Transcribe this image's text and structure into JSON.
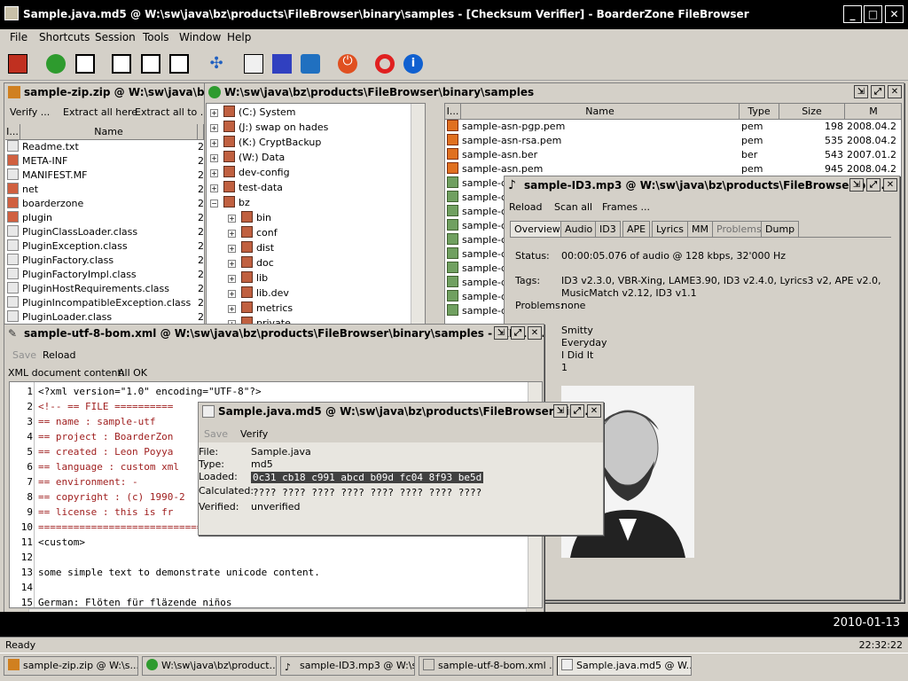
{
  "app": {
    "title": "Sample.java.md5 @ W:\\sw\\java\\bz\\products\\FileBrowser\\binary\\samples - [Checksum Verifier] - BoarderZone FileBrowser"
  },
  "menu": [
    "File",
    "Shortcuts",
    "Session",
    "Tools",
    "Window",
    "Help"
  ],
  "zip": {
    "title": "sample-zip.zip @ W:\\sw\\java\\bz\\pr",
    "toolbar": [
      "Verify ...",
      "Extract all here",
      "Extract all to ..."
    ],
    "col_i": "I...",
    "col_name": "Name",
    "files": [
      "Readme.txt",
      "META-INF",
      "MANIFEST.MF",
      "net",
      "boarderzone",
      "plugin",
      "PluginClassLoader.class",
      "PluginException.class",
      "PluginFactory.class",
      "PluginFactoryImpl.class",
      "PluginHostRequirements.class",
      "PluginIncompatibleException.class",
      "PluginLoader.class"
    ],
    "sizes": [
      "2",
      "2",
      "2",
      "2",
      "2",
      "2",
      "2",
      "2",
      "2",
      "2",
      "2",
      "2",
      "2"
    ]
  },
  "browser": {
    "title": "W:\\sw\\java\\bz\\products\\FileBrowser\\binary\\samples",
    "tree": [
      "(C:) System",
      "(J:) swap on hades",
      "(K:) CryptBackup",
      "(W:) Data",
      "dev-config",
      "test-data",
      "bz",
      "bin",
      "conf",
      "dist",
      "doc",
      "lib",
      "lib.dev",
      "metrics",
      "private"
    ],
    "cols": {
      "i": "I...",
      "name": "Name",
      "type": "Type",
      "size": "Size",
      "m": "M"
    },
    "files": [
      {
        "name": "sample-asn-pgp.pem",
        "type": "pem",
        "size": "198",
        "date": "2008.04.2"
      },
      {
        "name": "sample-asn-rsa.pem",
        "type": "pem",
        "size": "535",
        "date": "2008.04.2"
      },
      {
        "name": "sample-asn.ber",
        "type": "ber",
        "size": "543",
        "date": "2007.01.2"
      },
      {
        "name": "sample-asn.pem",
        "type": "pem",
        "size": "945",
        "date": "2008.04.2"
      }
    ],
    "more": [
      "sample-ce",
      "sample-ce",
      "sample-ce",
      "sample-ce",
      "sample-ce",
      "sample-co",
      "sample-di",
      "sample-di",
      "sample-di",
      "sample-di"
    ]
  },
  "mp3": {
    "title": "sample-ID3.mp3 @ W:\\sw\\java\\bz\\products\\FileBrowser\\bin...",
    "toolbar": [
      "Reload",
      "Scan all",
      "Frames ..."
    ],
    "tabs": [
      "Overview",
      "Audio",
      "ID3",
      "APE",
      "Lyrics",
      "MM",
      "Problems",
      "Dump"
    ],
    "status_label": "Status:",
    "status": "00:00:05.076 of audio @ 128 kbps, 32'000 Hz",
    "tags_label": "Tags:",
    "tags1": "ID3 v2.3.0, VBR-Xing, LAME3.90, ID3 v2.4.0, Lyrics3 v2, APE v2.0,",
    "tags2": "MusicMatch v2.12, ID3 v1.1",
    "problems_label": "Problems:",
    "problems": "none",
    "info": [
      "Smitty",
      "Everyday",
      "I Did It",
      "1"
    ]
  },
  "xml": {
    "title": "sample-utf-8-bom.xml @ W:\\sw\\java\\bz\\products\\FileBrowser\\binary\\samples - [XML E...",
    "save": "Save",
    "reload": "Reload",
    "content_label": "XML document content:",
    "content_status": "All OK",
    "lines": [
      "<?xml version=\"1.0\" encoding=\"UTF-8\"?>",
      "<!-- == FILE ==========",
      "== name       : sample-utf",
      "== project    : BoarderZon",
      "== created    : Leon Poyya",
      "== language   : custom xml",
      "== environment: -",
      "== copyright  : (c) 1990-2",
      "== license    : this is fr",
      "=============================",
      "<custom>",
      "",
      "  some simple text to demonstrate unicode content.",
      "",
      "  German:   Flöten für fläzende niños"
    ],
    "nums": [
      "1",
      "2",
      "3",
      "4",
      "5",
      "6",
      "7",
      "8",
      "9",
      "10",
      "11",
      "12",
      "13",
      "14",
      "15"
    ]
  },
  "md5": {
    "title": "Sample.java.md5 @ W:\\sw\\java\\bz\\products\\FileBrowser\\bin...",
    "save": "Save",
    "verify": "Verify",
    "file_label": "File:",
    "file": "Sample.java",
    "type_label": "Type:",
    "type": "md5",
    "loaded_label": "Loaded:",
    "loaded": "0c31 cb18 c991 abcd b09d fc04 8f93 be5d",
    "calc_label": "Calculated:",
    "calc": "???? ???? ???? ???? ???? ???? ???? ????",
    "verified_label": "Verified:",
    "verified": "unverified"
  },
  "clock": {
    "date": "2010-01-13",
    "time": "22:32:22"
  },
  "status": {
    "text": "Ready"
  },
  "taskbar": [
    "sample-zip.zip @ W:\\s...",
    "W:\\sw\\java\\bz\\product...",
    "sample-ID3.mp3 @ W:\\s...",
    "sample-utf-8-bom.xml ...",
    "Sample.java.md5 @ W..."
  ]
}
